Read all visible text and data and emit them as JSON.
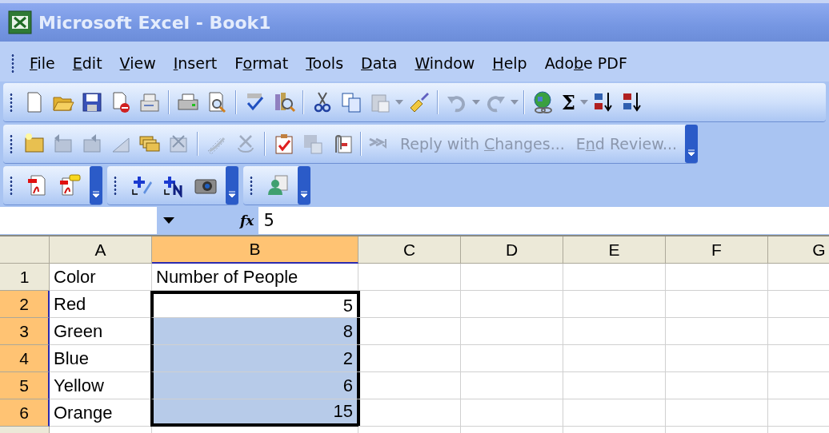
{
  "window": {
    "title": "Microsoft Excel - Book1"
  },
  "menu": [
    {
      "key": "F",
      "post": "ile"
    },
    {
      "key": "E",
      "post": "dit"
    },
    {
      "key": "V",
      "post": "iew"
    },
    {
      "key": "I",
      "post": "nsert"
    },
    {
      "pre": "F",
      "key": "o",
      "post": "rmat"
    },
    {
      "key": "T",
      "post": "ools"
    },
    {
      "key": "D",
      "post": "ata"
    },
    {
      "key": "W",
      "post": "indow"
    },
    {
      "key": "H",
      "post": "elp"
    },
    {
      "pre": "Ado",
      "key": "b",
      "post": "e PDF"
    }
  ],
  "standard_toolbar": {
    "autosum_symbol": "Σ"
  },
  "reviewing_toolbar": {
    "commands": [
      {
        "pre": "Reply with ",
        "key": "C",
        "post": "hanges...",
        "disabled": true
      },
      {
        "pre": "E",
        "key": "n",
        "post": "d Review...",
        "disabled": true
      }
    ]
  },
  "formula_bar": {
    "function_symbol": "fx",
    "value": "5"
  },
  "sheet": {
    "columns": [
      {
        "label": "A",
        "selected": false
      },
      {
        "label": "B",
        "selected": true
      },
      {
        "label": "C",
        "selected": false
      },
      {
        "label": "D",
        "selected": false
      },
      {
        "label": "E",
        "selected": false
      },
      {
        "label": "F",
        "selected": false
      },
      {
        "label": "G",
        "selected": false
      }
    ],
    "rows": [
      {
        "label": "1",
        "selected": false,
        "cells": [
          {
            "value": "Color",
            "kind": "text",
            "selected": false
          },
          {
            "value": "Number of People",
            "kind": "text",
            "selected": false
          }
        ]
      },
      {
        "label": "2",
        "selected": true,
        "cells": [
          {
            "value": "Red",
            "kind": "text",
            "selected": false
          },
          {
            "value": "5",
            "kind": "number",
            "selected": true
          }
        ]
      },
      {
        "label": "3",
        "selected": true,
        "cells": [
          {
            "value": "Green",
            "kind": "text",
            "selected": false
          },
          {
            "value": "8",
            "kind": "number",
            "selected": true
          }
        ]
      },
      {
        "label": "4",
        "selected": true,
        "cells": [
          {
            "value": "Blue",
            "kind": "text",
            "selected": false
          },
          {
            "value": "2",
            "kind": "number",
            "selected": true
          }
        ]
      },
      {
        "label": "5",
        "selected": true,
        "cells": [
          {
            "value": "Yellow",
            "kind": "text",
            "selected": false
          },
          {
            "value": "6",
            "kind": "number",
            "selected": true
          }
        ]
      },
      {
        "label": "6",
        "selected": true,
        "cells": [
          {
            "value": "Orange",
            "kind": "text",
            "selected": false
          },
          {
            "value": "15",
            "kind": "number",
            "selected": true
          }
        ]
      }
    ]
  }
}
